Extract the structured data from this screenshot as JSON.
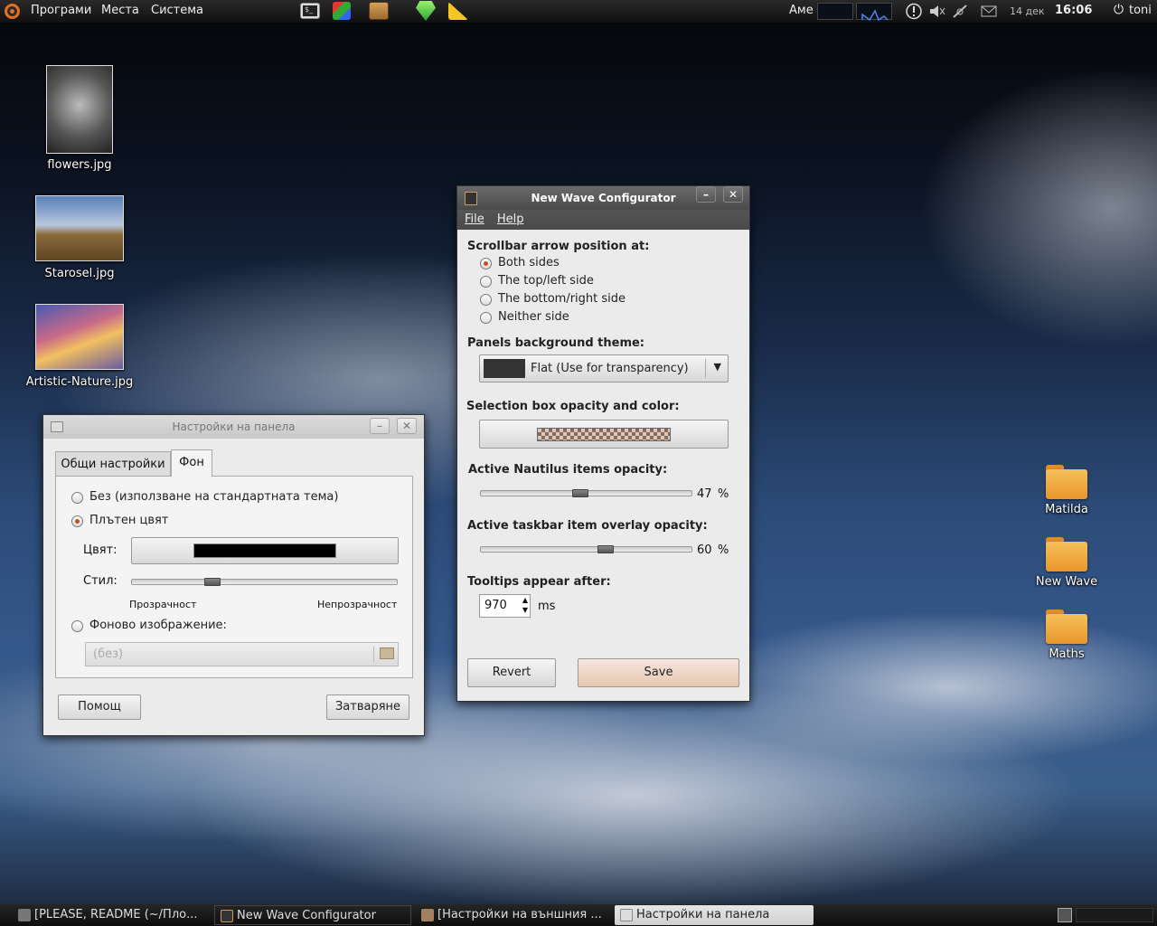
{
  "top_panel": {
    "menus": [
      "Програми",
      "Места",
      "Система"
    ],
    "launchers": [
      "terminal-icon",
      "cube-icon",
      "package-icon",
      "gem-icon",
      "ruler-icon"
    ],
    "keyboard_layout": "Аме",
    "date": "14 дек",
    "time": "16:06",
    "user": "toni"
  },
  "desktop_icons": {
    "left": [
      {
        "label": "flowers.jpg"
      },
      {
        "label": "Starosel.jpg"
      },
      {
        "label": "Artistic-Nature.jpg"
      }
    ],
    "right": [
      {
        "label": "Matilda"
      },
      {
        "label": "New Wave"
      },
      {
        "label": "Maths"
      }
    ]
  },
  "panel_settings": {
    "title": "Настройки на панела",
    "tabs": [
      "Общи настройки",
      "Фон"
    ],
    "active_tab": "Фон",
    "options": {
      "none": "Без (използване на стандартната тема)",
      "solid": "Плътен цвят",
      "image": "Фоново изображение:"
    },
    "selected_option": "solid",
    "color_label": "Цвят:",
    "color_value": "#000000",
    "style_label": "Стил:",
    "style_value": 0.29,
    "transparent_label": "Прозрачност",
    "opaque_label": "Непрозрачност",
    "image_placeholder": "(без)",
    "help_button": "Помощ",
    "close_button": "Затваряне"
  },
  "configurator": {
    "title": "New Wave Configurator",
    "menu": [
      "File",
      "Help"
    ],
    "scrollbar_heading": "Scrollbar arrow position at:",
    "scrollbar_options": [
      "Both sides",
      "The top/left side",
      "The bottom/right side",
      "Neither side"
    ],
    "scrollbar_selected": 0,
    "panels_heading": "Panels background theme:",
    "panels_value": "Flat (Use for transparency)",
    "selection_heading": "Selection box opacity and color:",
    "nautilus_heading": "Active Nautilus items opacity:",
    "nautilus_value": "47",
    "taskbar_heading": "Active taskbar item overlay opacity:",
    "taskbar_value": "60",
    "percent": "%",
    "tooltips_heading": "Tooltips appear after:",
    "tooltips_value": "970",
    "tooltips_unit": "ms",
    "revert_button": "Revert",
    "save_button": "Save"
  },
  "taskbar": [
    {
      "label": "[PLEASE, README (~/Пло...",
      "active": false
    },
    {
      "label": "New Wave Configurator",
      "active": false
    },
    {
      "label": "[Настройки на външния ...",
      "active": false
    },
    {
      "label": "Настройки на панела",
      "active": true
    }
  ]
}
